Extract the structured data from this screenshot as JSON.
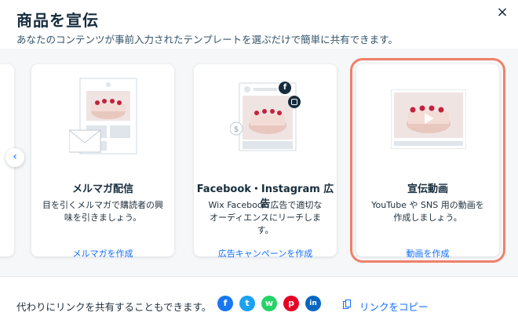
{
  "header": {
    "title": "商品を宣伝",
    "subtitle": "あなたのコンテンツが事前入力されたテンプレートを選ぶだけで簡単に共有できます。",
    "close_symbol": "×"
  },
  "carousel": {
    "prev_symbol": "‹",
    "cards": [
      {
        "title": "メルマガ配信",
        "desc": "目を引くメルマガで購読者の興味を引きましょう。",
        "link": "メルマガを作成"
      },
      {
        "title": "Facebook・Instagram 広告",
        "desc": "Wix Facebook 広告で適切なオーディエンスにリーチします。",
        "link": "広告キャンペーンを作成"
      },
      {
        "title": "宣伝動画",
        "desc": "YouTube や SNS 用の動画を作成しましょう。",
        "link": "動画を作成"
      }
    ]
  },
  "footer": {
    "text": "代わりにリンクを共有することもできます。",
    "copy_link": "リンクをコピー",
    "social": [
      {
        "icon": "facebook-icon",
        "glyph": "f",
        "color": "#1877f2"
      },
      {
        "icon": "twitter-icon",
        "glyph": "t",
        "color": "#1da1f2"
      },
      {
        "icon": "whatsapp-icon",
        "glyph": "w",
        "color": "#25d366"
      },
      {
        "icon": "pinterest-icon",
        "glyph": "p",
        "color": "#e60023"
      },
      {
        "icon": "linkedin-icon",
        "glyph": "in",
        "color": "#0a66c2"
      }
    ]
  },
  "colors": {
    "accent": "#116dff",
    "selection": "#f0806a"
  }
}
